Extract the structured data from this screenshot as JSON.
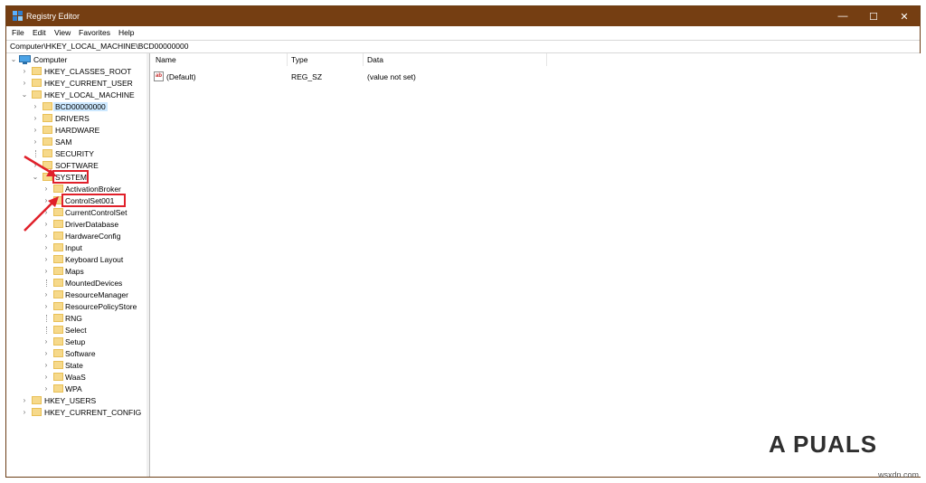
{
  "window": {
    "title": "Registry Editor",
    "controls": {
      "minimize": "—",
      "maximize": "☐",
      "close": "✕"
    }
  },
  "menu": [
    "File",
    "Edit",
    "View",
    "Favorites",
    "Help"
  ],
  "address": "Computer\\HKEY_LOCAL_MACHINE\\BCD00000000",
  "tree": {
    "root": "Computer",
    "hkcr": "HKEY_CLASSES_ROOT",
    "hkcu": "HKEY_CURRENT_USER",
    "hklm": "HKEY_LOCAL_MACHINE",
    "hklm_children": [
      "BCD00000000",
      "DRIVERS",
      "HARDWARE",
      "SAM",
      "SECURITY",
      "SOFTWARE",
      "SYSTEM"
    ],
    "system_children": [
      "ActivationBroker",
      "ControlSet001",
      "CurrentControlSet",
      "DriverDatabase",
      "HardwareConfig",
      "Input",
      "Keyboard Layout",
      "Maps",
      "MountedDevices",
      "ResourceManager",
      "ResourcePolicyStore",
      "RNG",
      "Select",
      "Setup",
      "Software",
      "State",
      "WaaS",
      "WPA"
    ],
    "hku": "HKEY_USERS",
    "hkcc": "HKEY_CURRENT_CONFIG"
  },
  "list": {
    "columns": [
      "Name",
      "Type",
      "Data"
    ],
    "rows": [
      {
        "name": "(Default)",
        "type": "REG_SZ",
        "data": "(value not set)",
        "icon": "ab"
      }
    ]
  },
  "branding": {
    "logo": "A PUALS",
    "watermark": "wsxdn.com"
  },
  "colors": {
    "titlebar": "#753e12",
    "highlight": "#e0202a",
    "folder": "#f6d98b",
    "selection": "#cce8ff"
  }
}
